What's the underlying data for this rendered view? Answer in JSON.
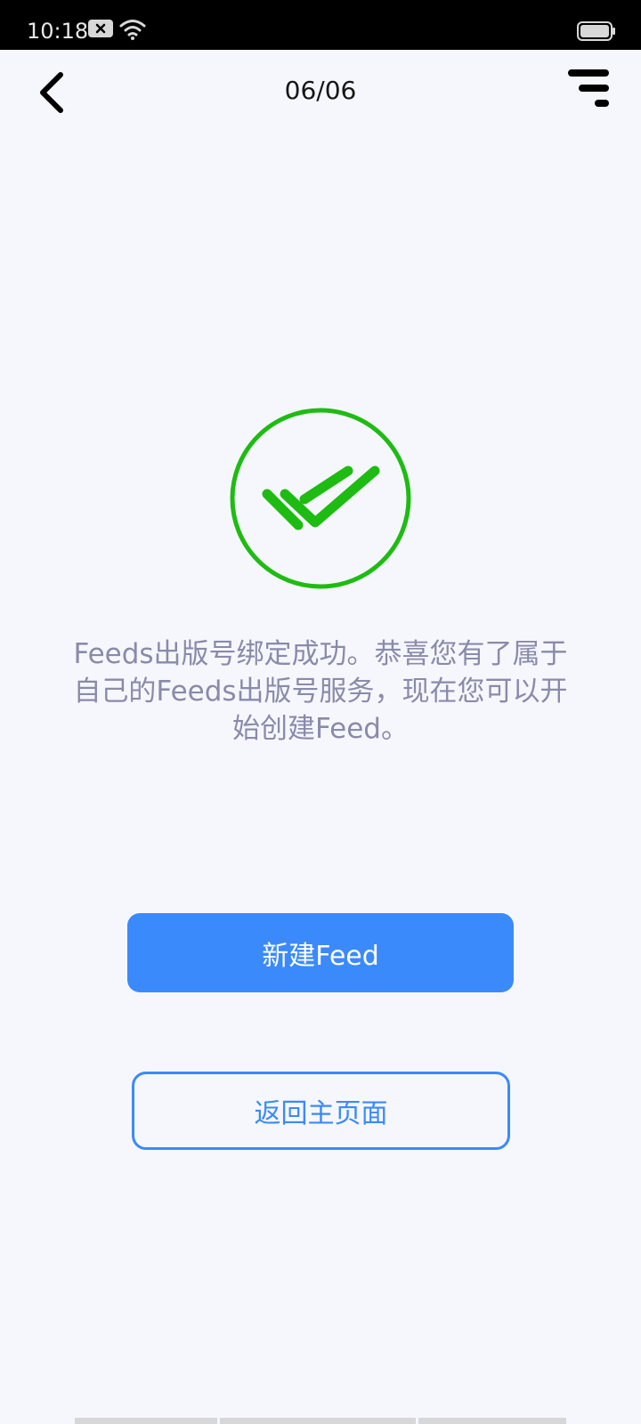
{
  "status_bar": {
    "time": "10:18",
    "icons": [
      "notification-x-icon",
      "wifi-icon",
      "battery-icon"
    ]
  },
  "header": {
    "title": "06/06",
    "back_icon": "chevron-left-icon",
    "menu_icon": "menu-lines-icon"
  },
  "success": {
    "icon": "double-check-circle-icon",
    "icon_color": "#1ebc12",
    "message": "Feeds出版号绑定成功。恭喜您有了属于自己的Feeds出版号服务，现在您可以开始创建Feed。"
  },
  "actions": {
    "primary_label": "新建Feed",
    "secondary_label": "返回主页面",
    "accent_color": "#3b8afb"
  }
}
